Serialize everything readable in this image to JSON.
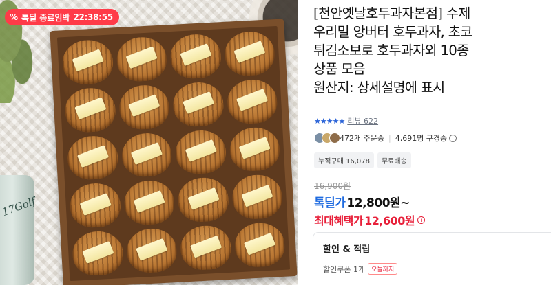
{
  "deal": {
    "badge_icon": "%",
    "label": "톡딜 종료임박",
    "timer": "22:38:55",
    "color": "#ff3b48"
  },
  "product": {
    "title": "[천안옛날호두과자본점] 수제\n우리밀 앙버터 호두과자, 초코\n튀김소보로 호두과자외 10종\n상품 모음\n원산지: 상세설명에 표시",
    "image_text": "17Golf",
    "rating_stars": "★★★★★",
    "review_label": "리뷰 622"
  },
  "social": {
    "orders": "472개 주문중",
    "viewers": "4,691명 구경중",
    "info_icon": "i"
  },
  "tags": [
    "누적구매 16,078",
    "무료배송"
  ],
  "pricing": {
    "original": "16,900원",
    "deal_label": "톡딜가",
    "deal_value": "12,800원~",
    "max_label": "최대혜택가",
    "max_value": "12,600원",
    "max_info_icon": "i",
    "accent_blue": "#1f6be0",
    "accent_red": "#e8203a"
  },
  "benefits": {
    "title": "할인 & 적립",
    "coupon_text": "할인쿠폰 1개",
    "coupon_badge": "오늘까지"
  }
}
